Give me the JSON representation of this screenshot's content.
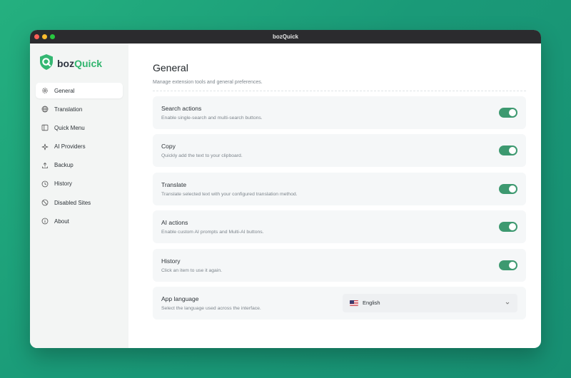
{
  "window": {
    "title": "bozQuick"
  },
  "brand": {
    "name_dark": "boz",
    "name_accent": "Quick"
  },
  "sidebar": {
    "items": [
      {
        "label": "General",
        "icon": "gear-icon",
        "active": true
      },
      {
        "label": "Translation",
        "icon": "globe-icon",
        "active": false
      },
      {
        "label": "Quick Menu",
        "icon": "panel-icon",
        "active": false
      },
      {
        "label": "AI Providers",
        "icon": "sparkle-icon",
        "active": false
      },
      {
        "label": "Backup",
        "icon": "upload-icon",
        "active": false
      },
      {
        "label": "History",
        "icon": "clock-icon",
        "active": false
      },
      {
        "label": "Disabled Sites",
        "icon": "ban-icon",
        "active": false
      },
      {
        "label": "About",
        "icon": "info-icon",
        "active": false
      }
    ]
  },
  "main": {
    "title": "General",
    "subtitle": "Manage extension tools and general preferences.",
    "settings": [
      {
        "title": "Search actions",
        "desc": "Enable single-search and multi-search buttons.",
        "enabled": true
      },
      {
        "title": "Copy",
        "desc": "Quickly add the text to your clipboard.",
        "enabled": true
      },
      {
        "title": "Translate",
        "desc": "Translate selected text with your configured translation method.",
        "enabled": true
      },
      {
        "title": "AI actions",
        "desc": "Enable custom AI prompts and Multi-AI buttons.",
        "enabled": true
      },
      {
        "title": "History",
        "desc": "Click an item to use it again.",
        "enabled": true
      }
    ],
    "language": {
      "title": "App language",
      "desc": "Select the language used across the interface.",
      "value": "English"
    }
  },
  "colors": {
    "accent": "#31b56e",
    "toggle_on": "#3d9970"
  }
}
